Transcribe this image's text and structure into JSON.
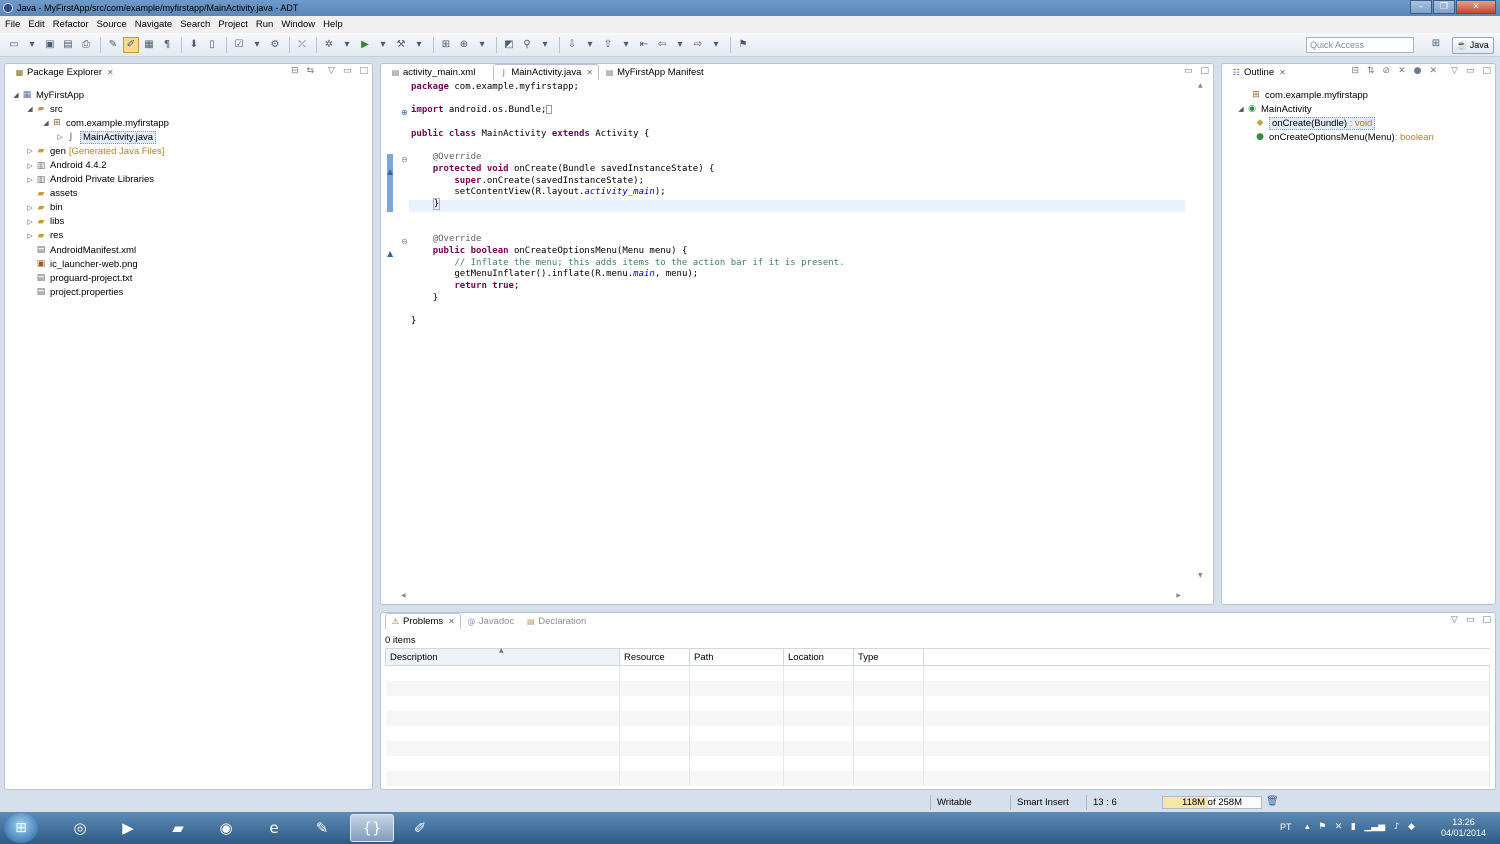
{
  "window": {
    "title": "Java - MyFirstApp/src/com/example/myfirstapp/MainActivity.java - ADT"
  },
  "menu": [
    "File",
    "Edit",
    "Refactor",
    "Source",
    "Navigate",
    "Search",
    "Project",
    "Run",
    "Window",
    "Help"
  ],
  "toolbar": {
    "quick_access_placeholder": "Quick Access",
    "perspective": "Java"
  },
  "package_explorer": {
    "title": "Package Explorer",
    "tree": [
      {
        "label": "MyFirstApp",
        "level": 0,
        "expanded": true,
        "icon": "project-icon"
      },
      {
        "label": "src",
        "level": 1,
        "expanded": true,
        "icon": "source-folder-icon"
      },
      {
        "label": "com.example.myfirstapp",
        "level": 2,
        "expanded": true,
        "icon": "package-icon"
      },
      {
        "label": "MainActivity.java",
        "level": 3,
        "expanded": false,
        "icon": "java-file-icon",
        "selected": true
      },
      {
        "label": "gen",
        "decoration": "[Generated Java Files]",
        "level": 1,
        "expanded": false,
        "icon": "source-folder-icon"
      },
      {
        "label": "Android 4.4.2",
        "level": 1,
        "expanded": false,
        "icon": "library-icon"
      },
      {
        "label": "Android Private Libraries",
        "level": 1,
        "expanded": false,
        "icon": "library-icon"
      },
      {
        "label": "assets",
        "level": 1,
        "expanded": false,
        "icon": "folder-icon"
      },
      {
        "label": "bin",
        "level": 1,
        "expanded": false,
        "icon": "folder-icon"
      },
      {
        "label": "libs",
        "level": 1,
        "expanded": false,
        "icon": "folder-icon"
      },
      {
        "label": "res",
        "level": 1,
        "expanded": false,
        "icon": "folder-icon"
      },
      {
        "label": "AndroidManifest.xml",
        "level": 1,
        "expanded": false,
        "icon": "xml-file-icon"
      },
      {
        "label": "ic_launcher-web.png",
        "level": 1,
        "expanded": false,
        "icon": "image-file-icon"
      },
      {
        "label": "proguard-project.txt",
        "level": 1,
        "expanded": false,
        "icon": "text-file-icon"
      },
      {
        "label": "project.properties",
        "level": 1,
        "expanded": false,
        "icon": "text-file-icon"
      }
    ]
  },
  "editor": {
    "tabs": [
      {
        "label": "activity_main.xml",
        "active": false
      },
      {
        "label": "MainActivity.java",
        "active": true
      },
      {
        "label": "MyFirstApp Manifest",
        "active": false
      }
    ],
    "code": {
      "l1_kw": "package",
      "l1_rest": " com.example.myfirstapp;",
      "l2_kw": "import",
      "l2_rest": " android.os.Bundle;",
      "l3_kw1": "public class",
      "l3_mid": " MainActivity ",
      "l3_kw2": "extends",
      "l3_rest": " Activity {",
      "override": "@Override",
      "l5_kw": "protected void",
      "l5_rest": " onCreate(Bundle savedInstanceState) {",
      "l6_kw": "super",
      "l6_rest": ".onCreate(savedInstanceState);",
      "l7_pre": "setContentView(R.layout.",
      "l7_it": "activity_main",
      "l7_post": ");",
      "close": "}",
      "l10_kw": "public boolean",
      "l10_rest": " onCreateOptionsMenu(Menu menu) {",
      "l11_comment": "// Inflate the menu; this adds items to the action bar if it is present.",
      "l12_pre": "getMenuInflater().inflate(R.menu.",
      "l12_it": "main",
      "l12_post": ", menu);",
      "l13_kw": "return true",
      "l13_rest": ";"
    }
  },
  "outline": {
    "title": "Outline",
    "items": [
      {
        "label": "com.example.myfirstapp",
        "type": ""
      },
      {
        "label": "MainActivity",
        "type": ""
      },
      {
        "label": "onCreate(Bundle)",
        "type": " : void",
        "selected": true
      },
      {
        "label": "onCreateOptionsMenu(Menu)",
        "type": " : boolean"
      }
    ]
  },
  "problems": {
    "tabs": [
      "Problems",
      "Javadoc",
      "Declaration"
    ],
    "count": "0 items",
    "columns": [
      "Description",
      "Resource",
      "Path",
      "Location",
      "Type"
    ]
  },
  "status": {
    "writable": "Writable",
    "insert_mode": "Smart Insert",
    "position": "13 : 6",
    "heap": "118M of 258M",
    "heap_used_fraction": 0.46
  },
  "taskbar": {
    "lang": "PT",
    "time": "13:26",
    "date": "04/01/2014"
  }
}
